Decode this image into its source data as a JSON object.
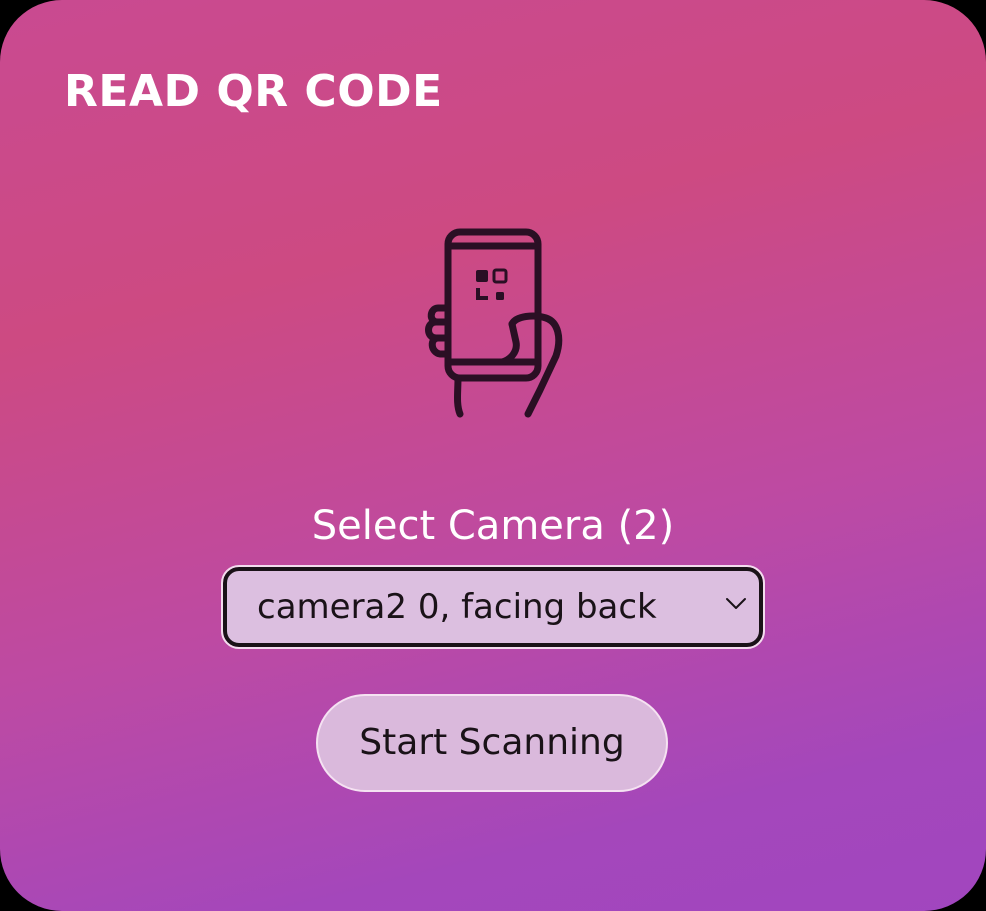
{
  "app": {
    "title": "READ QR CODE"
  },
  "icons": {
    "hero": "phone-qr-hand-icon",
    "dropdown": "chevron-down-icon"
  },
  "camera": {
    "label": "Select Camera (2)",
    "selected": "camera2 0, facing back"
  },
  "actions": {
    "start_label": "Start Scanning"
  },
  "colors": {
    "gradient_top": "#c94a91",
    "gradient_bottom": "#a146bf",
    "text": "#ffffff",
    "control_fill": "#dab9dc",
    "control_text": "#1a1218"
  }
}
